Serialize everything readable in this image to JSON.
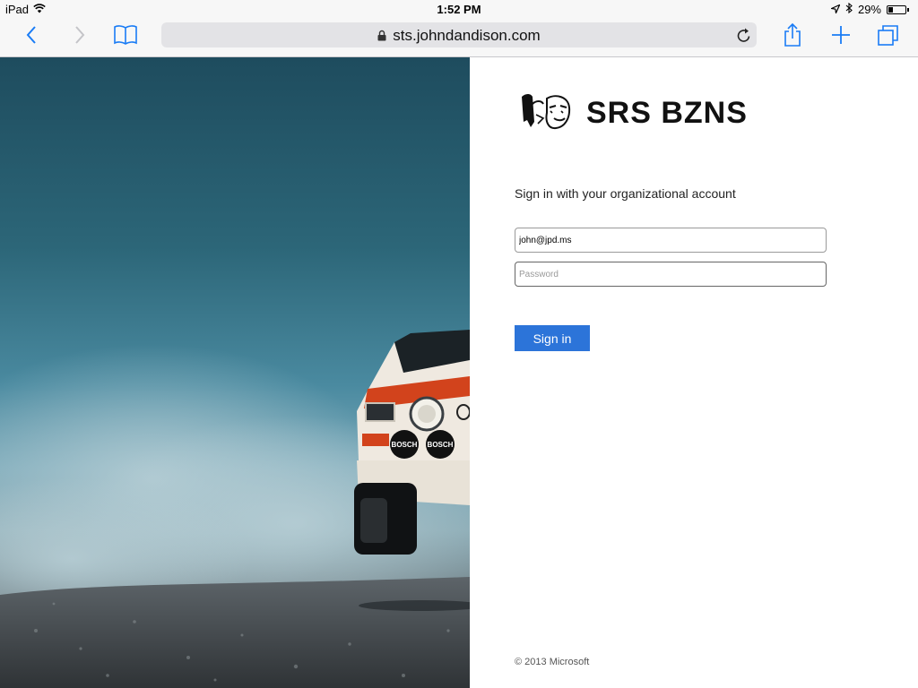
{
  "status_bar": {
    "device": "iPad",
    "time": "1:52 PM",
    "battery": "29%",
    "battery_level": 0.29
  },
  "browser": {
    "url": "sts.johndandison.com",
    "icons": [
      "back-icon",
      "forward-icon",
      "bookmarks-icon",
      "lock-icon",
      "reload-icon",
      "share-icon",
      "new-tab-icon",
      "tabs-icon"
    ]
  },
  "hero": {
    "decals": [
      "BOSCH",
      "BOSCH"
    ]
  },
  "login": {
    "logo_text": "SRS BZNS",
    "title": "Sign in with your organizational account",
    "username_value": "john@jpd.ms",
    "password_placeholder": "Password",
    "signin_label": "Sign in",
    "footer": "© 2013 Microsoft"
  },
  "colors": {
    "accent": "#2c74d9",
    "ios_blue": "#1a7cf5"
  }
}
